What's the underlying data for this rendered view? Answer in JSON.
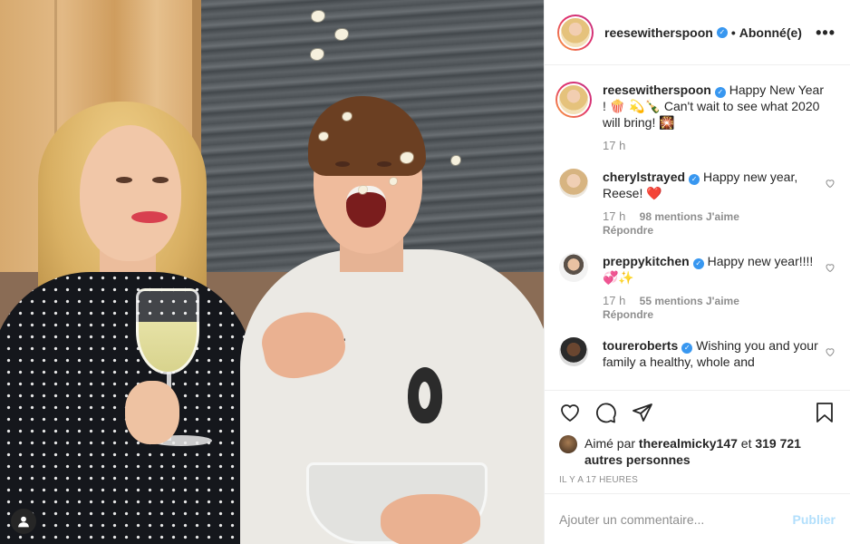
{
  "post": {
    "author": "reesewitherspoon",
    "separator": "•",
    "follow_status": "Abonné(e)",
    "more_icon": "more-options-icon"
  },
  "caption": {
    "user": "reesewitherspoon",
    "text": "Happy New Year ! 🍿 💫🍾 Can't wait to see what 2020 will bring! 🎇",
    "time": "17 h"
  },
  "comments": [
    {
      "user": "cherylstrayed",
      "text": "Happy new year, Reese! ❤️",
      "time": "17 h",
      "likes": "98 mentions J'aime",
      "reply": "Répondre"
    },
    {
      "user": "preppykitchen",
      "text": "Happy new year!!!!💞✨",
      "time": "17 h",
      "likes": "55 mentions J'aime",
      "reply": "Répondre"
    },
    {
      "user": "toureroberts",
      "text": "Wishing you and your family a healthy, whole and",
      "time": "",
      "likes": "",
      "reply": ""
    }
  ],
  "actions": {
    "icons": [
      "heart-icon",
      "comment-icon",
      "share-icon",
      "bookmark-icon"
    ]
  },
  "likes": {
    "prefix": "Aimé par",
    "user": "therealmicky147",
    "mid": "et",
    "count": "319 721 autres personnes"
  },
  "timestamp": "IL Y A 17 HEURES",
  "add_comment": {
    "placeholder": "Ajouter un commentaire...",
    "post_label": "Publier"
  },
  "colors": {
    "verified": "#3897f0",
    "post_button_disabled": "#b2dffc",
    "heart_red": "#ed4956"
  }
}
